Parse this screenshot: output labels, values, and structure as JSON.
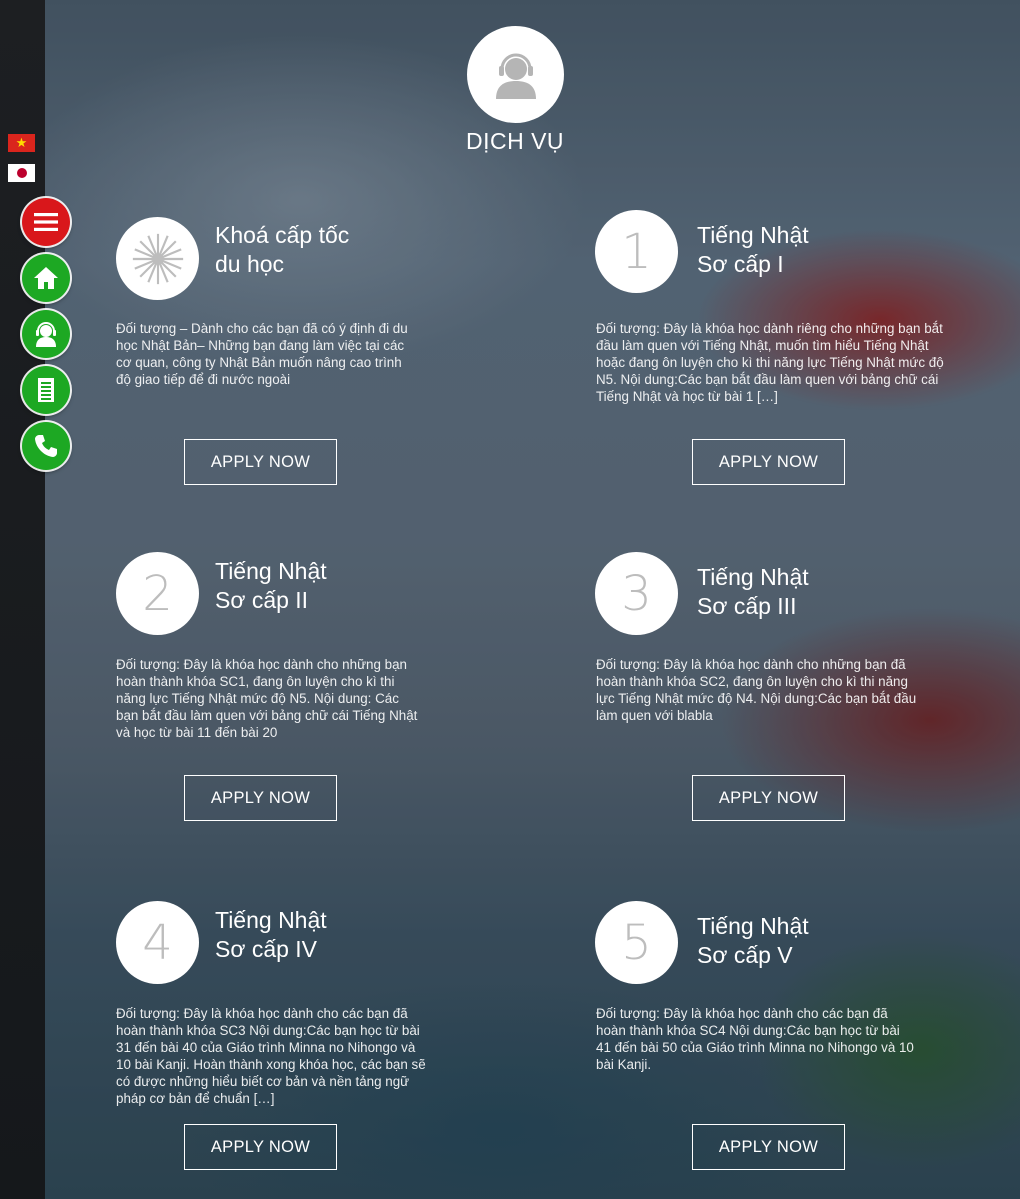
{
  "sidebar": {
    "languages": [
      {
        "code": "vi",
        "icon": "vietnam-flag-icon"
      },
      {
        "code": "ja",
        "icon": "japan-flag-icon"
      }
    ],
    "buttons": [
      {
        "icon": "menu-icon",
        "color": "#d9171b"
      },
      {
        "icon": "home-icon",
        "color": "#1da823"
      },
      {
        "icon": "headset-support-icon",
        "color": "#1da823"
      },
      {
        "icon": "document-icon",
        "color": "#1da823"
      },
      {
        "icon": "phone-icon",
        "color": "#1da823"
      }
    ]
  },
  "header": {
    "icon": "headset-support-icon",
    "title": "DỊCH VỤ"
  },
  "apply_label": "APPLY NOW",
  "courses": [
    {
      "badge": "",
      "badge_icon": "flower-icon",
      "title_line1": "Khoá cấp tốc",
      "title_line2": "du học",
      "description": "Đối tượng – Dành cho các bạn đã có ý định đi du học Nhật Bản– Những bạn đang làm việc tại các cơ quan, công ty Nhật Bản muốn nâng cao trình độ giao tiếp để đi nước ngoài"
    },
    {
      "badge": "1",
      "title_line1": "Tiếng Nhật",
      "title_line2": "Sơ cấp I",
      "description": "Đối tượng: Đây là khóa học dành riêng cho những bạn bắt đầu làm quen với Tiếng Nhật, muốn tìm hiểu Tiếng Nhật hoặc đang ôn luyện cho kì thi năng lực Tiếng Nhật mức độ N5. Nội dung:Các bạn bắt đầu làm quen với bảng chữ cái Tiếng Nhật và học từ bài 1 […]"
    },
    {
      "badge": "2",
      "title_line1": "Tiếng Nhật",
      "title_line2": "Sơ cấp II",
      "description": "Đối tượng: Đây là khóa học dành cho những bạn hoàn thành khóa SC1, đang ôn luyện cho kì thi năng lực Tiếng Nhật mức độ N5. Nội dung: Các bạn bắt đầu làm quen với bảng chữ cái Tiếng Nhật và học từ bài 11 đến bài 20"
    },
    {
      "badge": "3",
      "title_line1": "Tiếng Nhật",
      "title_line2": "Sơ cấp III",
      "description": "Đối tượng: Đây là khóa học dành cho những bạn đã hoàn thành khóa SC2, đang ôn luyện cho kì thi năng lực Tiếng Nhật mức độ N4. Nội dung:Các bạn bắt đầu làm quen với blabla"
    },
    {
      "badge": "4",
      "title_line1": "Tiếng Nhật",
      "title_line2": "Sơ cấp IV",
      "description": "Đối tượng: Đây là khóa học dành cho các bạn đã hoàn thành khóa SC3 Nội dung:Các bạn học từ bài 31 đến bài 40 của Giáo trình Minna no Nihongo và 10 bài Kanji. Hoàn thành xong khóa học, các bạn sẽ có được những hiểu biết cơ bản và nền tảng ngữ pháp cơ bản để chuẩn […]"
    },
    {
      "badge": "5",
      "title_line1": "Tiếng Nhật",
      "title_line2": "Sơ cấp V",
      "description": "Đối tượng: Đây là khóa học dành cho các bạn đã hoàn thành khóa SC4 Nội dung:Các bạn học từ bài 41 đến bài 50 của Giáo trình Minna no Nihongo và 10 bài Kanji."
    }
  ]
}
